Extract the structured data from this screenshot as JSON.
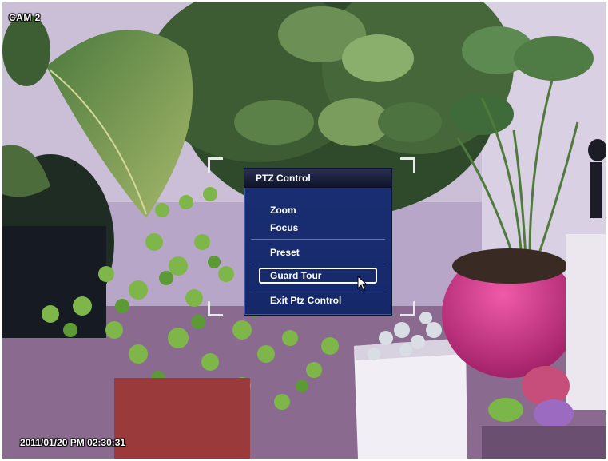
{
  "camera": {
    "label": "CAM 2"
  },
  "overlay": {
    "timestamp": "2011/01/20 PM 02:30:31"
  },
  "ptz_menu": {
    "title": "PTZ Control",
    "items": [
      {
        "label": "Zoom"
      },
      {
        "label": "Focus"
      },
      {
        "label": "Preset"
      },
      {
        "label": "Guard Tour",
        "selected": true
      },
      {
        "label": "Exit Ptz Control"
      }
    ]
  },
  "icons": {
    "pointer": "mouse-pointer-icon"
  }
}
